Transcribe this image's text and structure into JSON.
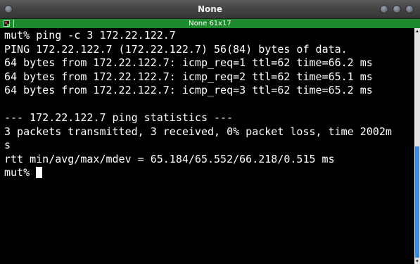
{
  "window": {
    "title": "None",
    "geometry_label": "None 61x17"
  },
  "terminal": {
    "lines": [
      "mut% ping -c 3 172.22.122.7",
      "PING 172.22.122.7 (172.22.122.7) 56(84) bytes of data.",
      "64 bytes from 172.22.122.7: icmp_req=1 ttl=62 time=66.2 ms",
      "64 bytes from 172.22.122.7: icmp_req=2 ttl=62 time=65.1 ms",
      "64 bytes from 172.22.122.7: icmp_req=3 ttl=62 time=65.2 ms",
      "",
      "--- 172.22.122.7 ping statistics ---",
      "3 packets transmitted, 3 received, 0% packet loss, time 2002m",
      "s",
      "rtt min/avg/max/mdev = 65.184/65.552/66.218/0.515 ms"
    ],
    "prompt": "mut% "
  },
  "scrollbar": {
    "up_glyph": "▴",
    "down_glyph": "▾"
  },
  "colors": {
    "terminal_bg": "#000000",
    "terminal_fg": "#ffffff",
    "tab_bar": "#1d8b2d",
    "scroll_thumb": "#3a8ee6"
  }
}
